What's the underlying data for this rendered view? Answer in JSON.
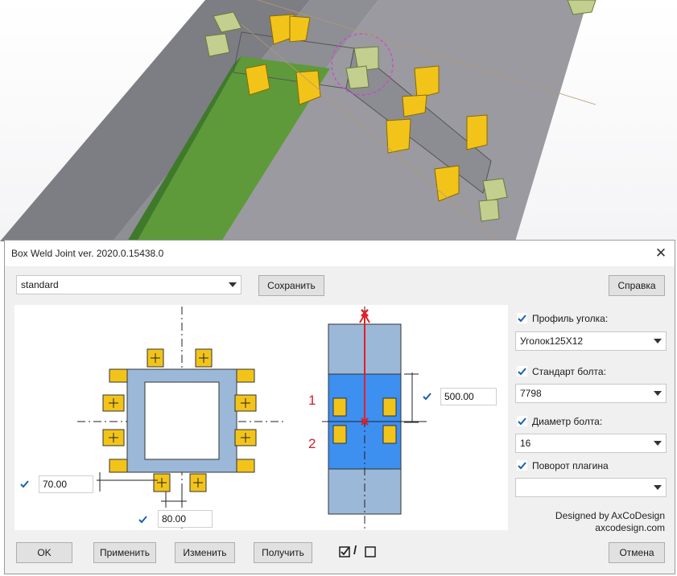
{
  "dialog": {
    "title": "Box Weld Joint ver. 2020.0.15438.0",
    "close_glyph": "✕",
    "preset": "standard",
    "save_label": "Сохранить",
    "help_label": "Справка"
  },
  "drawing": {
    "left_dim_x": "70.00",
    "left_dim_y": "80.00",
    "right_dim": "500.00",
    "side_label_1": "1",
    "side_label_2": "2"
  },
  "options": {
    "angle_profile": {
      "label": "Профиль уголка:",
      "checked": true,
      "value": "Уголок125X12"
    },
    "bolt_standard": {
      "label": "Стандарт болта:",
      "checked": true,
      "value": "7798"
    },
    "bolt_diameter": {
      "label": "Диаметр болта:",
      "checked": true,
      "value": "16"
    },
    "plugin_rotation": {
      "label": "Поворот плагина",
      "checked": true,
      "value": ""
    }
  },
  "credit": {
    "line1": "Designed by AxCoDesign",
    "line2": "axcodesign.com"
  },
  "footer": {
    "ok": "OK",
    "apply": "Применить",
    "modify": "Изменить",
    "get": "Получить",
    "toggle_sep": "/",
    "cancel": "Отмена"
  },
  "colors": {
    "beam_gray": "#8f8f96",
    "plate_green": "#5e9a3a",
    "angle_yellow": "#f2c41a",
    "bolt_block": "#c2cf8f",
    "profile_blue": "#9bb8d8",
    "highlight_blue": "#3d8ff0",
    "dim_red": "#e0202a",
    "check_blue": "#1a5fb4"
  }
}
